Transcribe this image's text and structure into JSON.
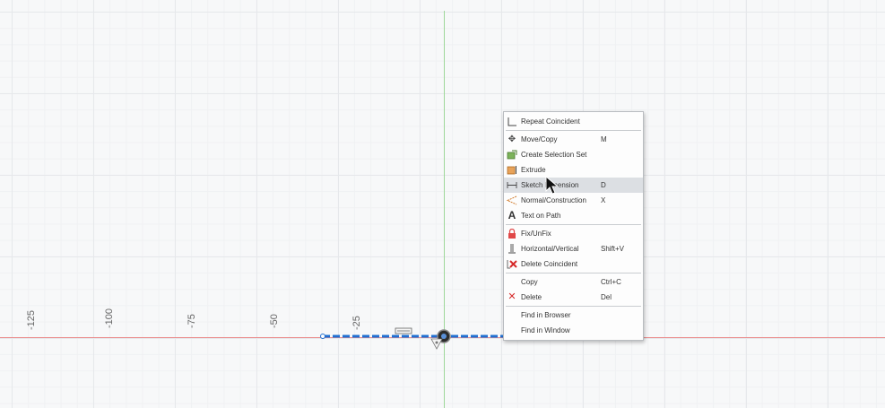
{
  "axis_labels": [
    "-125",
    "-100",
    "-75",
    "-50",
    "-25"
  ],
  "context_menu": {
    "groups": [
      [
        {
          "label": "Repeat Coincident",
          "shortcut": "",
          "icon": "repeat-coincident-icon"
        }
      ],
      [
        {
          "label": "Move/Copy",
          "shortcut": "M",
          "icon": "move-icon"
        },
        {
          "label": "Create Selection Set",
          "shortcut": "",
          "icon": "selection-set-icon"
        },
        {
          "label": "Extrude",
          "shortcut": "",
          "icon": "extrude-icon"
        },
        {
          "label": "Sketch Dimension",
          "shortcut": "D",
          "icon": "sketch-dimension-icon",
          "highlighted": true
        },
        {
          "label": "Normal/Construction",
          "shortcut": "X",
          "icon": "construction-icon"
        },
        {
          "label": "Text on Path",
          "shortcut": "",
          "icon": "text-icon"
        }
      ],
      [
        {
          "label": "Fix/UnFix",
          "shortcut": "",
          "icon": "lock-icon"
        },
        {
          "label": "Horizontal/Vertical",
          "shortcut": "Shift+V",
          "icon": "horizontal-vertical-icon"
        },
        {
          "label": "Delete Coincident",
          "shortcut": "",
          "icon": "delete-coincident-icon"
        }
      ],
      [
        {
          "label": "Copy",
          "shortcut": "Ctrl+C",
          "icon": ""
        },
        {
          "label": "Delete",
          "shortcut": "Del",
          "icon": "delete-icon"
        }
      ],
      [
        {
          "label": "Find in Browser",
          "shortcut": "",
          "icon": ""
        },
        {
          "label": "Find in Window",
          "shortcut": "",
          "icon": ""
        }
      ]
    ]
  },
  "colors": {
    "sketch_line": "#1f6fd1",
    "x_axis": "#ea8b8b",
    "y_axis": "#9fd89a",
    "delete_red": "#d62a2a"
  }
}
